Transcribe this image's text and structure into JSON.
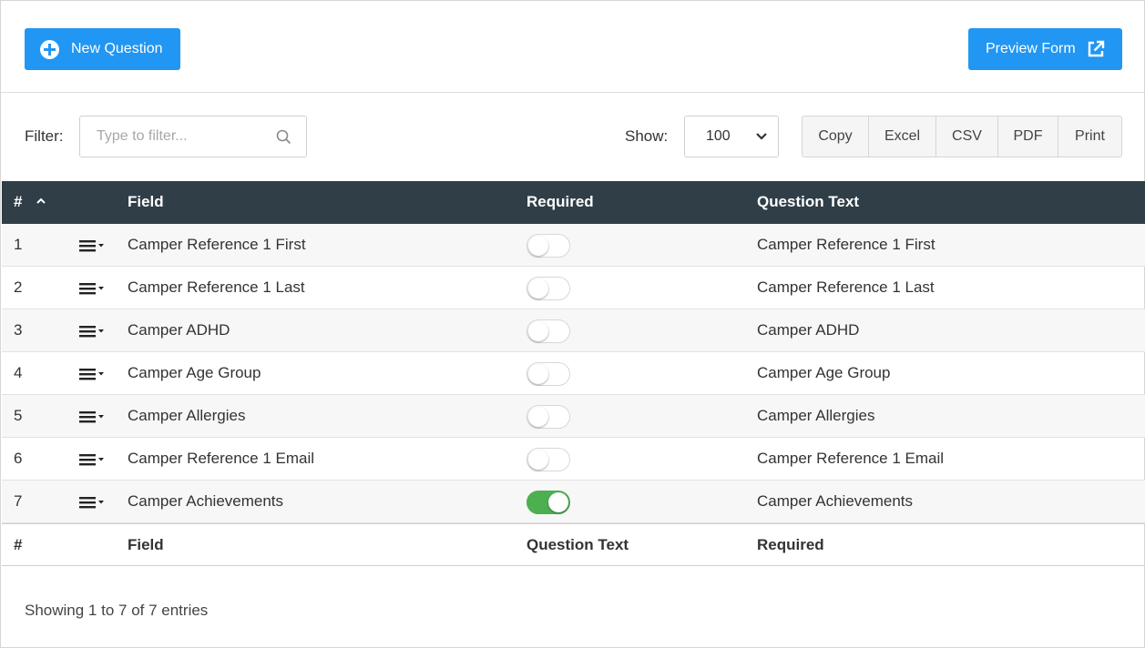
{
  "toolbar_top": {
    "new_question_label": "New Question",
    "preview_form_label": "Preview Form"
  },
  "filter": {
    "label": "Filter:",
    "placeholder": "Type to filter..."
  },
  "show": {
    "label": "Show:",
    "value": "100"
  },
  "export_buttons": [
    "Copy",
    "Excel",
    "CSV",
    "PDF",
    "Print"
  ],
  "table": {
    "headers": {
      "num": "#",
      "field": "Field",
      "required": "Required",
      "question_text": "Question Text"
    },
    "rows": [
      {
        "num": "1",
        "field": "Camper Reference 1 First",
        "required": false,
        "question_text": "Camper Reference 1 First"
      },
      {
        "num": "2",
        "field": "Camper Reference 1 Last",
        "required": false,
        "question_text": "Camper Reference 1 Last"
      },
      {
        "num": "3",
        "field": "Camper ADHD",
        "required": false,
        "question_text": "Camper ADHD"
      },
      {
        "num": "4",
        "field": "Camper Age Group",
        "required": false,
        "question_text": "Camper Age Group"
      },
      {
        "num": "5",
        "field": "Camper Allergies",
        "required": false,
        "question_text": "Camper Allergies"
      },
      {
        "num": "6",
        "field": "Camper Reference 1 Email",
        "required": false,
        "question_text": "Camper Reference 1 Email"
      },
      {
        "num": "7",
        "field": "Camper Achievements",
        "required": true,
        "question_text": "Camper Achievements"
      }
    ],
    "footers": {
      "num": "#",
      "field": "Field",
      "col3": "Question Text",
      "col4": "Required"
    }
  },
  "info": "Showing 1 to 7 of 7 entries",
  "colors": {
    "primary": "#2196f3",
    "header_bg": "#2f3e47",
    "toggle_on": "#4caf50"
  }
}
